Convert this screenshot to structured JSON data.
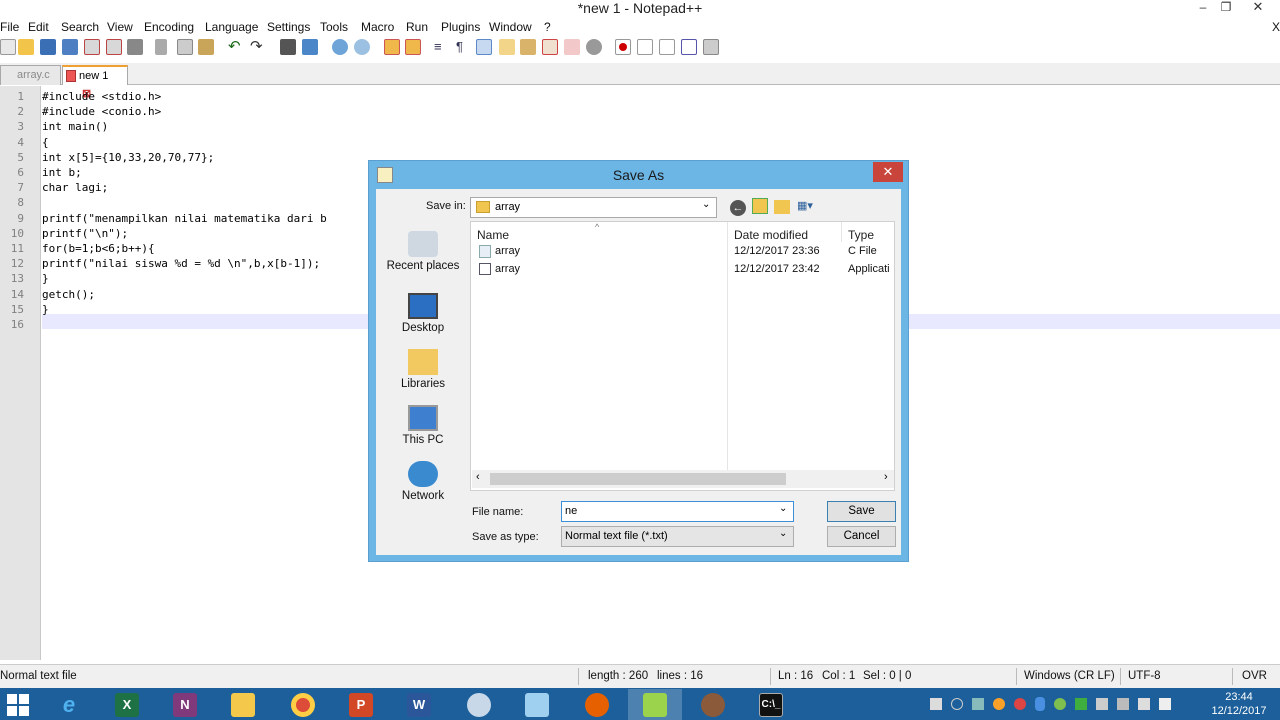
{
  "window": {
    "title": "*new 1 - Notepad++"
  },
  "menu": [
    "File",
    "Edit",
    "Search",
    "View",
    "Encoding",
    "Language",
    "Settings",
    "Tools",
    "Macro",
    "Run",
    "Plugins",
    "Window",
    "?"
  ],
  "tabs": [
    {
      "label": "array.c"
    },
    {
      "label": "new 1"
    }
  ],
  "editor": {
    "lines": [
      "#include <stdio.h>",
      "#include <conio.h>",
      "int main()",
      "{",
      "int x[5]={10,33,20,70,77};",
      "int b;",
      "char lagi;",
      "",
      "printf(\"menampilkan nilai matematika dari b",
      "printf(\"\\n\");",
      "for(b=1;b<6;b++){",
      "printf(\"nilai siswa %d = %d \\n\",b,x[b-1]);",
      "}",
      "getch();",
      "}",
      ""
    ],
    "line_numbers": [
      "1",
      "2",
      "3",
      "4",
      "5",
      "6",
      "7",
      "8",
      "9",
      "10",
      "11",
      "12",
      "13",
      "14",
      "15",
      "16"
    ]
  },
  "status": {
    "type": "Normal text file",
    "length": "length : 260",
    "lines": "lines : 16",
    "ln": "Ln : 16",
    "col": "Col : 1",
    "sel": "Sel : 0 | 0",
    "eol": "Windows (CR LF)",
    "encoding": "UTF-8",
    "mode": "OVR"
  },
  "dialog": {
    "title": "Save As",
    "save_in_label": "Save in:",
    "save_in_value": "array",
    "places": [
      "Recent places",
      "Desktop",
      "Libraries",
      "This PC",
      "Network"
    ],
    "columns": {
      "name": "Name",
      "date": "Date modified",
      "type": "Type"
    },
    "files": [
      {
        "name": "array",
        "date": "12/12/2017 23:36",
        "type": "C File"
      },
      {
        "name": "array",
        "date": "12/12/2017 23:42",
        "type": "Applicati"
      }
    ],
    "file_name_label": "File name:",
    "file_name_value": "ne",
    "save_type_label": "Save as type:",
    "save_type_value": "Normal text file (*.txt)",
    "save_button": "Save",
    "cancel_button": "Cancel"
  },
  "taskbar": {
    "time": "23:44",
    "date": "12/12/2017"
  },
  "colors": {
    "dialog_frame": "#6cb6e6",
    "taskbar": "#1c5f9a",
    "close_red": "#c9443a",
    "current_line": "#e8e8ff"
  }
}
